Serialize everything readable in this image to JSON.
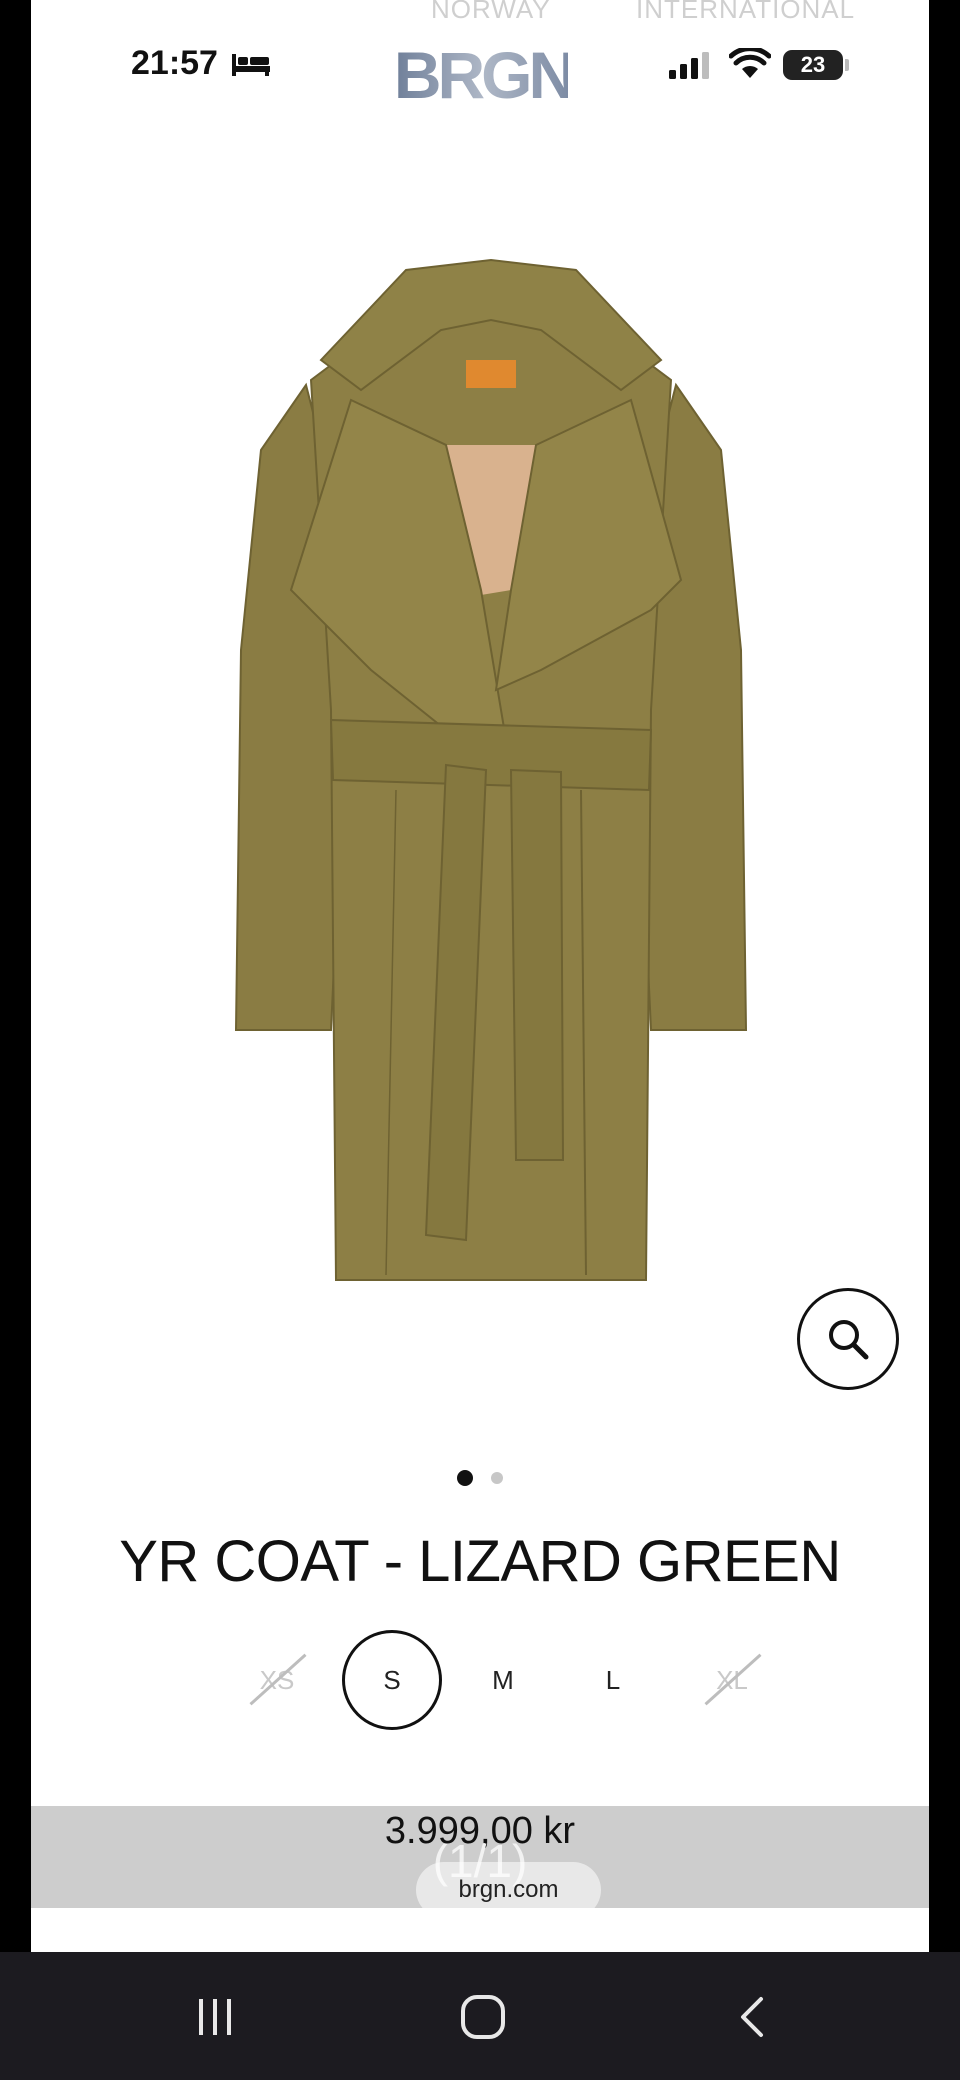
{
  "region_tabs": [
    "NORWAY",
    "INTERNATIONAL"
  ],
  "status_bar": {
    "time": "21:57",
    "battery": "23"
  },
  "brand": {
    "logo_text": "BRGN"
  },
  "product": {
    "title": "YR COAT - LIZARD GREEN",
    "color_hex": "#8a7c43",
    "image_count": 2,
    "active_image": 1,
    "sizes": [
      {
        "label": "XS",
        "available": false,
        "selected": false
      },
      {
        "label": "S",
        "available": true,
        "selected": true
      },
      {
        "label": "M",
        "available": true,
        "selected": false
      },
      {
        "label": "L",
        "available": true,
        "selected": false
      },
      {
        "label": "XL",
        "available": false,
        "selected": false
      }
    ],
    "price": "3.999,00 kr"
  },
  "browser": {
    "counter": "(1/1)",
    "url": "brgn.com"
  },
  "icons": {
    "zoom": "search-icon",
    "status": [
      "bed-icon",
      "signal-icon",
      "wifi-icon",
      "battery-icon"
    ],
    "nav": [
      "recent-apps-icon",
      "home-icon",
      "back-icon"
    ]
  }
}
